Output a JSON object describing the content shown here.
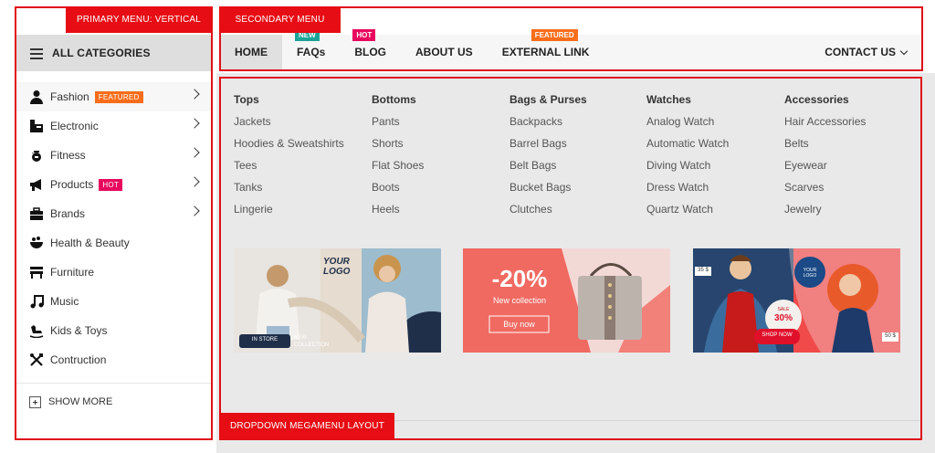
{
  "labels": {
    "primary": "PRIMARY MENU: VERTICAL",
    "secondary": "SECONDARY MENU",
    "dropdown": "DROPDOWN MEGAMENU LAYOUT"
  },
  "vertical_menu": {
    "header": "ALL CATEGORIES",
    "items": [
      {
        "label": "Fashion",
        "icon": "person-icon",
        "tag": "FEATURED",
        "has_arrow": true
      },
      {
        "label": "Electronic",
        "icon": "printer-icon",
        "tag": "",
        "has_arrow": true
      },
      {
        "label": "Fitness",
        "icon": "kettlebell-icon",
        "tag": "",
        "has_arrow": true
      },
      {
        "label": "Products",
        "icon": "megaphone-icon",
        "tag": "HOT",
        "has_arrow": true
      },
      {
        "label": "Brands",
        "icon": "briefcase-icon",
        "tag": "",
        "has_arrow": true
      },
      {
        "label": "Health & Beauty",
        "icon": "bowl-icon",
        "tag": "",
        "has_arrow": false
      },
      {
        "label": "Furniture",
        "icon": "bench-icon",
        "tag": "",
        "has_arrow": false
      },
      {
        "label": "Music",
        "icon": "music-note-icon",
        "tag": "",
        "has_arrow": false
      },
      {
        "label": "Kids & Toys",
        "icon": "rocking-horse-icon",
        "tag": "",
        "has_arrow": false
      },
      {
        "label": "Contruction",
        "icon": "tools-icon",
        "tag": "",
        "has_arrow": false
      }
    ],
    "show_more": "SHOW MORE"
  },
  "top_nav": {
    "items": [
      {
        "label": "HOME",
        "tag": ""
      },
      {
        "label": "FAQs",
        "tag": "NEW"
      },
      {
        "label": "BLOG",
        "tag": "HOT"
      },
      {
        "label": "ABOUT US",
        "tag": ""
      },
      {
        "label": "EXTERNAL LINK",
        "tag": "FEATURED"
      }
    ],
    "contact": "CONTACT US"
  },
  "mega": {
    "columns": [
      {
        "title": "Tops",
        "links": [
          "Jackets",
          "Hoodies & Sweatshirts",
          "Tees",
          "Tanks",
          "Lingerie"
        ]
      },
      {
        "title": "Bottoms",
        "links": [
          "Pants",
          "Shorts",
          "Flat Shoes",
          "Boots",
          "Heels"
        ]
      },
      {
        "title": "Bags & Purses",
        "links": [
          "Backpacks",
          "Barrel Bags",
          "Belt Bags",
          "Bucket Bags",
          "Clutches"
        ]
      },
      {
        "title": "Watches",
        "links": [
          "Analog Watch",
          "Automatic Watch",
          "Diving Watch",
          "Dress Watch",
          "Quartz Watch"
        ]
      },
      {
        "title": "Accessories",
        "links": [
          "Hair Accessories",
          "Belts",
          "Eyewear",
          "Scarves",
          "Jewelry"
        ]
      }
    ],
    "banners": {
      "b1": {
        "logo": "YOUR LOGO",
        "store": "IN STORE",
        "collection": "NEW COLLECTION"
      },
      "b2": {
        "discount": "-20%",
        "subtitle": "New collection",
        "button": "Buy now"
      },
      "b3": {
        "price_left": "35 $",
        "logo": "YOUR LOGO",
        "sale": "SALE",
        "sale_pct": "30%",
        "button": "SHOP NOW",
        "price_right": "50 $"
      }
    }
  },
  "colors": {
    "annotation": "#e70d14",
    "featured": "#f96d1a",
    "hot": "#e8085d",
    "new": "#1aa497"
  }
}
